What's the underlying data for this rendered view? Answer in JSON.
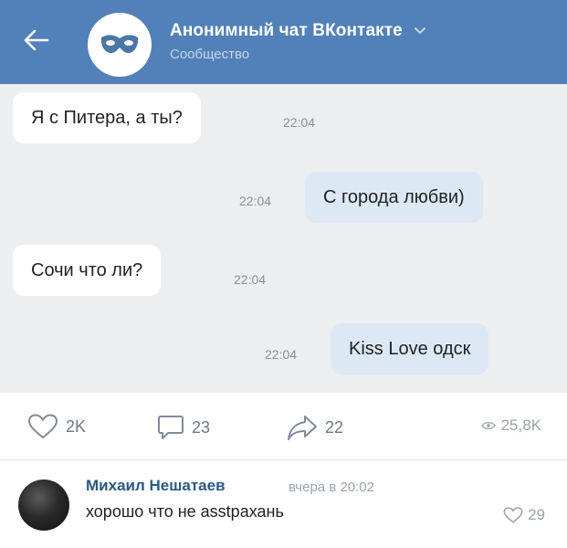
{
  "header": {
    "title": "Анонимный чат ВКонтакте",
    "subtitle": "Сообщество",
    "icons": [
      "back-arrow-icon",
      "mask-icon",
      "chevron-down-icon"
    ]
  },
  "messages": [
    {
      "direction": "in",
      "text": "Я с Питера, а ты?",
      "time": "22:04"
    },
    {
      "direction": "out",
      "text": "С города любви)",
      "time": "22:04"
    },
    {
      "direction": "in",
      "text": "Сочи что ли?",
      "time": "22:04"
    },
    {
      "direction": "out",
      "text": "Kiss Love одск",
      "time": "22:04"
    }
  ],
  "actions": {
    "likes": "2K",
    "comments": "23",
    "shares": "22",
    "views": "25,8K"
  },
  "comment": {
    "author": "Михаил Нешатаев",
    "date": "вчера в 20:02",
    "text": "хорошо что не аsstрахань",
    "likes": "29"
  },
  "colors": {
    "header_bg": "#5181b8",
    "chat_bg": "#edeef0",
    "bubble_in": "#ffffff",
    "bubble_out": "#dde8f5",
    "link": "#2a5885"
  }
}
